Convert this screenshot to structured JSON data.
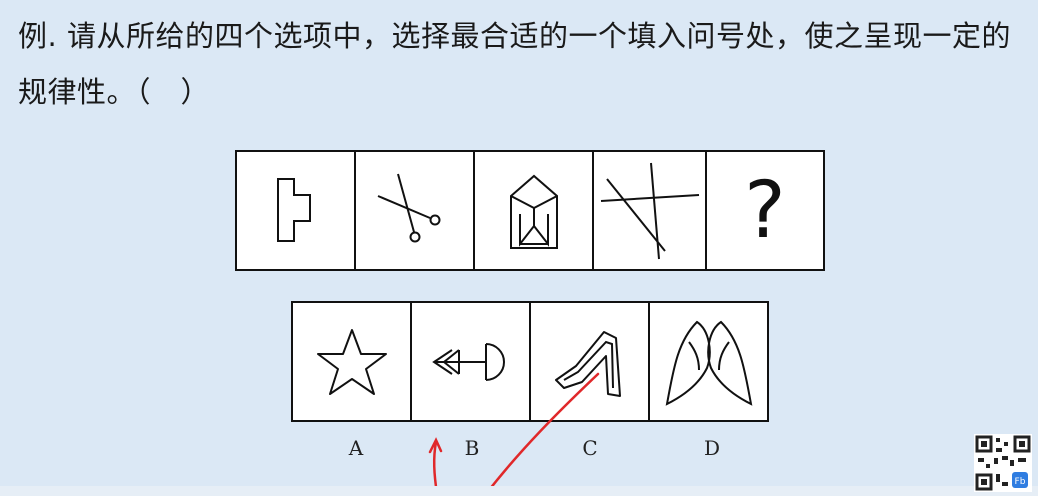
{
  "question": {
    "prefix": "例.",
    "text": "请从所给的四个选项中，选择最合适的一个填入问号处，使之呈现一定的规律性。（　）"
  },
  "question_row": {
    "placeholder": "?"
  },
  "options": [
    {
      "label": "A",
      "icon": "star-icon"
    },
    {
      "label": "B",
      "icon": "arrow-circle-icon"
    },
    {
      "label": "C",
      "icon": "bent-tube-icon"
    },
    {
      "label": "D",
      "icon": "two-leaves-icon"
    }
  ],
  "colors": {
    "background": "#dbe8f5",
    "line": "#111111",
    "annotation": "#e0282a"
  }
}
